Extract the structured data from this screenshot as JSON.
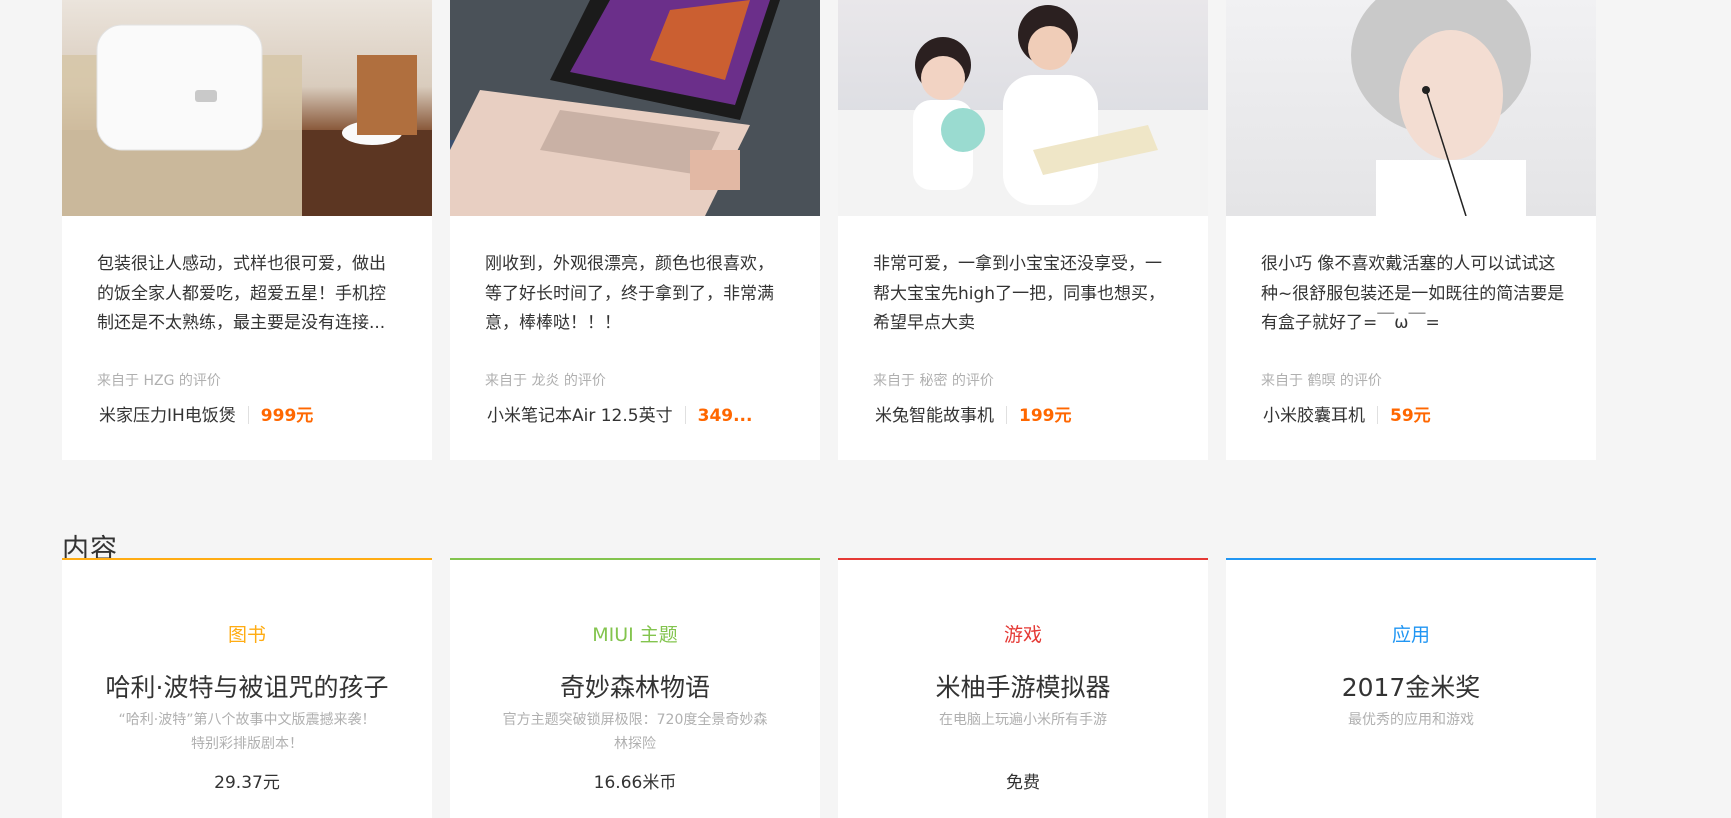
{
  "reviews": [
    {
      "text": "包装很让人感动，式样也很可爱，做出的饭全家人都爱吃，超爱五星！手机控制还是不太熟练，最主要是没有连接...",
      "author": "来自于 HZG 的评价",
      "product": "米家压力IH电饭煲",
      "price": "999元"
    },
    {
      "text": "刚收到，外观很漂亮，颜色也很喜欢，等了好长时间了，终于拿到了，非常满意，棒棒哒！！！",
      "author": "来自于 龙炎 的评价",
      "product": "小米笔记本Air 12.5英寸",
      "price": "349..."
    },
    {
      "text": "非常可爱，一拿到小宝宝还没享受，一帮大宝宝先high了一把，同事也想买，希望早点大卖",
      "author": "来自于 秘密 的评价",
      "product": "米兔智能故事机",
      "price": "199元"
    },
    {
      "text": "很小巧 像不喜欢戴活塞的人可以试试这种~很舒服包装还是一如既往的简洁要是有盒子就好了=￣ω￣=",
      "author": "来自于 鹤暝 的评价",
      "product": "小米胶囊耳机",
      "price": "59元"
    }
  ],
  "section": {
    "title": "内容"
  },
  "content": [
    {
      "category": "图书",
      "title": "哈利·波特与被诅咒的孩子",
      "desc": "“哈利·波特”第八个故事中文版震撼来袭！特别彩排版剧本！",
      "price": "29.37元",
      "color": "#ffac13"
    },
    {
      "category": "MIUI 主题",
      "title": "奇妙森林物语",
      "desc": "官方主题突破锁屏极限：720度全景奇妙森林探险",
      "price": "16.66米币",
      "color": "#83c44e"
    },
    {
      "category": "游戏",
      "title": "米柚手游模拟器",
      "desc": "在电脑上玩遍小米所有手游",
      "price": "免费",
      "color": "#e53935"
    },
    {
      "category": "应用",
      "title": "2017金米奖",
      "desc": "最优秀的应用和游戏",
      "price": "",
      "color": "#2196f3"
    }
  ],
  "colors": {
    "accent": "#ff6700",
    "background": "#f5f5f5"
  }
}
